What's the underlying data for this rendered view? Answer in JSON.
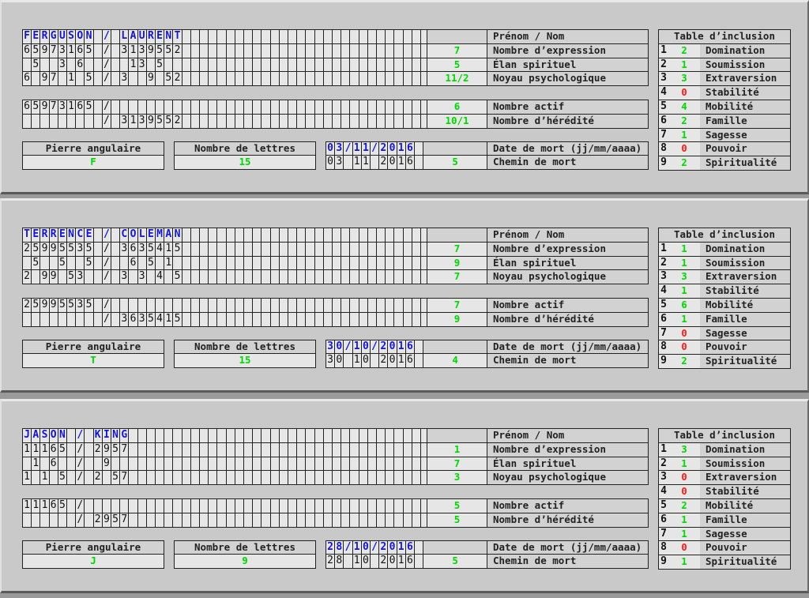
{
  "labels": {
    "name_header": "Prénom  / Nom",
    "expression": "Nombre d’expression",
    "elan": "Élan spirituel",
    "noyau": "Noyau psychologique",
    "actif": "Nombre actif",
    "heredite": "Nombre d’hérédité",
    "pierre": "Pierre angulaire",
    "nb_lettres": "Nombre de lettres",
    "date_mort": "Date de mort (jj/mm/aaaa)",
    "chemin": "Chemin de mort",
    "table_title": "Table d’inclusion",
    "table_items": [
      "Domination",
      "Soumission",
      "Extraversion",
      "Stabilité",
      "Mobilité",
      "Famille",
      "Sagesse",
      "Pouvoir",
      "Spiritualité"
    ]
  },
  "colors": {
    "letters": "#1515d0",
    "positive": "#00d800",
    "zero": "#ff1a1a"
  },
  "records": [
    {
      "name_row": "FERGUSON / LAURENT",
      "row_expr": "65973165 / 3139552",
      "row_elan": " 5  3 6  /  13 5",
      "row_noyau": "6 97 1 5 / 3  9 52",
      "row_actif": "65973165 /",
      "row_hered": "         / 3139552",
      "expression": "7",
      "elan": "5",
      "noyau": "11/2",
      "actif": "6",
      "heredite": "10/1",
      "pierre": "F",
      "nb_lettres": "15",
      "date_top": "03/11/2016",
      "date_bottom": "03 11 2016",
      "chemin": "5",
      "inclusion": [
        "2",
        "1",
        "3",
        "0",
        "4",
        "2",
        "1",
        "0",
        "2"
      ]
    },
    {
      "name_row": "TERRENCE / COLEMAN",
      "row_expr": "25995535 / 3635415",
      "row_elan": " 5  5  5 /  6 5 1",
      "row_noyau": "2 99 53  / 3 3 4 5",
      "row_actif": "25995535 /",
      "row_hered": "         / 3635415",
      "expression": "7",
      "elan": "9",
      "noyau": "7",
      "actif": "7",
      "heredite": "9",
      "pierre": "T",
      "nb_lettres": "15",
      "date_top": "30/10/2016",
      "date_bottom": "30 10 2016",
      "chemin": "4",
      "inclusion": [
        "1",
        "1",
        "3",
        "1",
        "6",
        "1",
        "0",
        "0",
        "2"
      ]
    },
    {
      "name_row": "JASON / KING",
      "row_expr": "11165 / 2957",
      "row_elan": " 1 6  /  9",
      "row_noyau": "1 1 5 / 2 57",
      "row_actif": "11165 /",
      "row_hered": "      / 2957",
      "expression": "1",
      "elan": "7",
      "noyau": "3",
      "actif": "5",
      "heredite": "5",
      "pierre": "J",
      "nb_lettres": "9",
      "date_top": "28/10/2016",
      "date_bottom": "28 10 2016",
      "chemin": "5",
      "inclusion": [
        "3",
        "1",
        "0",
        "0",
        "2",
        "1",
        "1",
        "0",
        "1"
      ]
    }
  ]
}
